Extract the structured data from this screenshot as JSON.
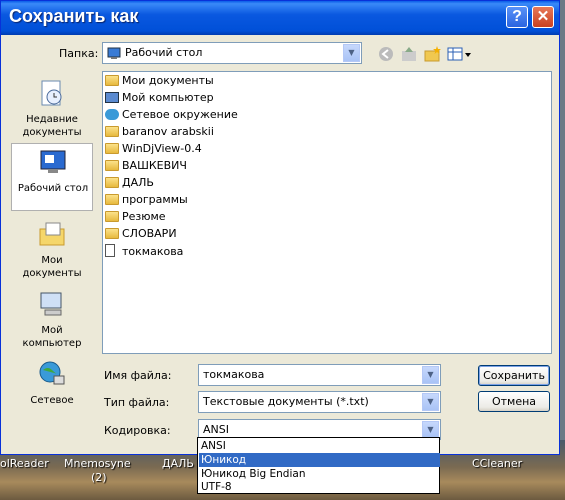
{
  "window": {
    "title": "Сохранить как",
    "help_label": "?",
    "close_label": "✕"
  },
  "folder": {
    "label": "Папка:",
    "value": "Рабочий стол",
    "toolbar_icons": [
      "back-icon",
      "up-folder-icon",
      "new-folder-icon",
      "view-menu-icon"
    ]
  },
  "sidebar": {
    "items": [
      {
        "label": "Недавние документы",
        "icon": "recent-documents-icon"
      },
      {
        "label": "Рабочий стол",
        "icon": "desktop-icon"
      },
      {
        "label": "Мои документы",
        "icon": "my-documents-icon"
      },
      {
        "label": "Мой компьютер",
        "icon": "my-computer-icon"
      },
      {
        "label": "Сетевое",
        "icon": "network-icon"
      }
    ]
  },
  "files": [
    {
      "name": "Мои документы",
      "icon": "my-documents-icon"
    },
    {
      "name": "Мой компьютер",
      "icon": "my-computer-icon"
    },
    {
      "name": "Сетевое окружение",
      "icon": "network-icon"
    },
    {
      "name": "baranov arabskii",
      "icon": "folder-icon"
    },
    {
      "name": "WinDjView-0.4",
      "icon": "folder-icon"
    },
    {
      "name": "ВАШКЕВИЧ",
      "icon": "folder-icon"
    },
    {
      "name": "ДАЛЬ",
      "icon": "folder-icon"
    },
    {
      "name": "программы",
      "icon": "folder-icon"
    },
    {
      "name": "Резюме",
      "icon": "folder-icon"
    },
    {
      "name": "СЛОВАРИ",
      "icon": "folder-icon"
    },
    {
      "name": "токмакова",
      "icon": "text-file-icon"
    }
  ],
  "filename": {
    "label": "Имя файла:",
    "value": "токмакова"
  },
  "filetype": {
    "label": "Тип файла:",
    "value": "Текстовые документы (*.txt)"
  },
  "encoding": {
    "label": "Кодировка:",
    "value": "ANSI",
    "options": [
      "ANSI",
      "Юникод",
      "Юникод Big Endian",
      "UTF-8"
    ],
    "highlighted_index": 1
  },
  "buttons": {
    "save": "Сохранить",
    "cancel": "Отмена"
  },
  "desktop": {
    "labels": [
      "olReader",
      "Mnemosyne",
      "(2)",
      "ДАЛЬ",
      "CCleaner"
    ]
  },
  "colors": {
    "titlebar": "#0050d8",
    "selection": "#316ac5",
    "dialog_bg": "#ece9d8"
  }
}
